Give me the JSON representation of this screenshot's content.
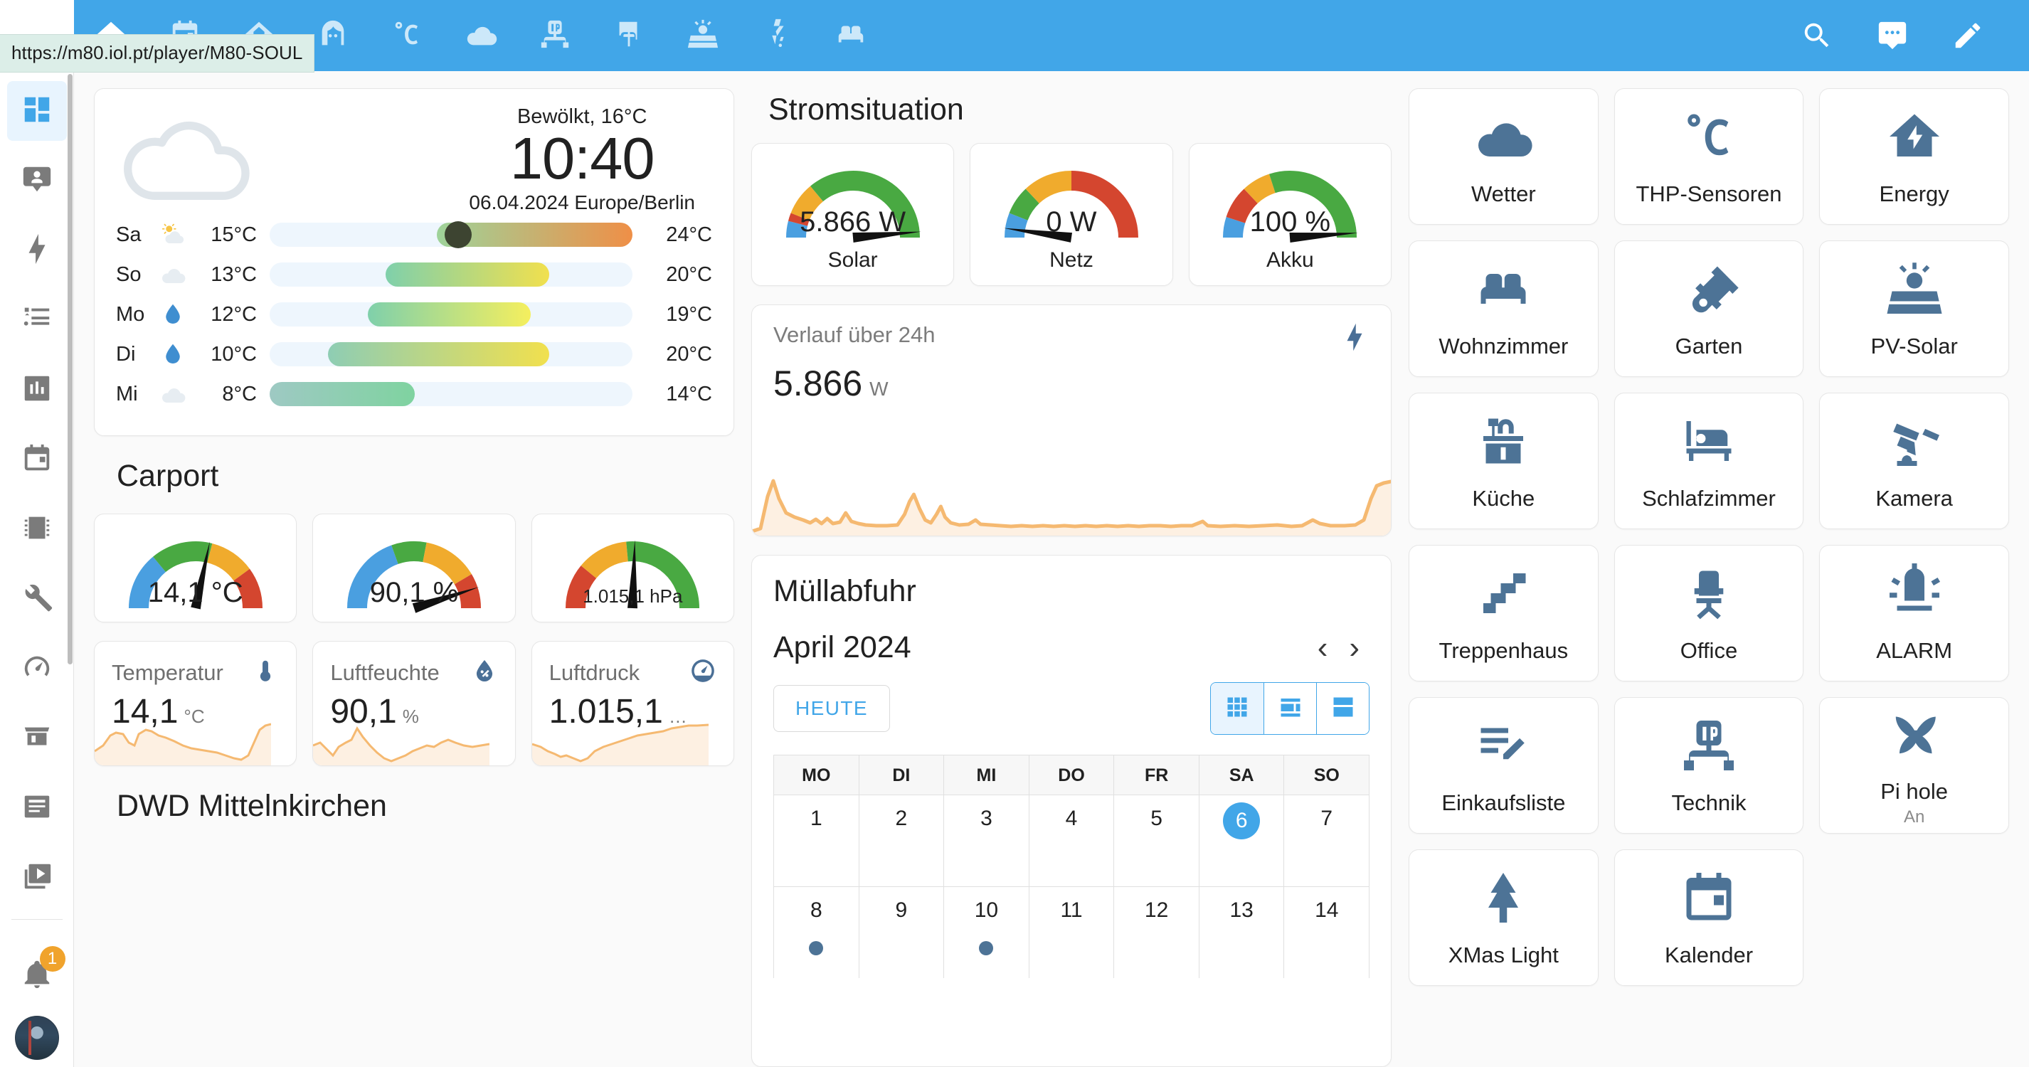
{
  "topbar": {
    "url_tooltip": "https://m80.iol.pt/player/M80-SOUL",
    "tabs": [
      {
        "name": "home",
        "icon": "home-icon",
        "active": true
      },
      {
        "name": "calendar",
        "icon": "calendar-icon",
        "active": false
      },
      {
        "name": "house",
        "icon": "house-icon",
        "active": false
      },
      {
        "name": "person",
        "icon": "person-face-icon",
        "active": false
      },
      {
        "name": "temperature",
        "icon": "celsius-icon",
        "active": false
      },
      {
        "name": "weather",
        "icon": "cloud-icon",
        "active": false
      },
      {
        "name": "network",
        "icon": "ip-network-icon",
        "active": false
      },
      {
        "name": "garage",
        "icon": "garage-door-icon",
        "active": false
      },
      {
        "name": "solar",
        "icon": "solar-panel-icon",
        "active": false
      },
      {
        "name": "energy",
        "icon": "flash-alert-icon",
        "active": false
      },
      {
        "name": "livingroom",
        "icon": "sofa-icon",
        "active": false
      }
    ],
    "actions": [
      {
        "name": "search",
        "icon": "search-icon",
        "label": "Suchen"
      },
      {
        "name": "assist",
        "icon": "assist-icon",
        "label": "Assist"
      },
      {
        "name": "edit",
        "icon": "pencil-icon",
        "label": "Bearbeiten"
      }
    ]
  },
  "sidebar": {
    "items": [
      {
        "name": "overview",
        "icon": "view-dashboard-icon",
        "active": true
      },
      {
        "name": "map",
        "icon": "account-badge-icon",
        "active": false
      },
      {
        "name": "energy",
        "icon": "lightning-bolt-icon",
        "active": false
      },
      {
        "name": "logbook",
        "icon": "format-list-icon",
        "active": false
      },
      {
        "name": "history",
        "icon": "chart-box-icon",
        "active": false
      },
      {
        "name": "calendar",
        "icon": "calendar-icon",
        "active": false
      },
      {
        "name": "esphome",
        "icon": "chip-icon",
        "active": false
      },
      {
        "name": "tools",
        "icon": "wrench-icon",
        "active": false
      },
      {
        "name": "speedtest",
        "icon": "speedometer-icon",
        "active": false
      },
      {
        "name": "hacs",
        "icon": "hacs-icon",
        "active": false,
        "label": "HACS"
      },
      {
        "name": "file-editor",
        "icon": "file-document-icon",
        "active": false
      },
      {
        "name": "media",
        "icon": "media-play-icon",
        "active": false
      }
    ],
    "notifications_count": "1",
    "notification_icon": "bell-icon",
    "avatar": "user-avatar"
  },
  "left_column": {
    "weather": {
      "condition": "Bewölkt, 16°C",
      "time": "10:40",
      "date": "06.04.2024 Europe/Berlin",
      "icon": "cloudy-icon",
      "forecast": [
        {
          "day": "Sa",
          "icon": "partly-cloudy-icon",
          "low": "15°C",
          "high": "24°C",
          "bar_start_pct": 46,
          "bar_end_pct": 100,
          "marker_pct": 52,
          "grad_from": "#9ed39a",
          "grad_to": "#ef8f47"
        },
        {
          "day": "So",
          "icon": "cloudy-icon",
          "low": "13°C",
          "high": "20°C",
          "bar_start_pct": 32,
          "bar_end_pct": 77,
          "marker_pct": null,
          "grad_from": "#7fd0ab",
          "grad_to": "#f1e04e"
        },
        {
          "day": "Mo",
          "icon": "rainy-icon",
          "low": "12°C",
          "high": "19°C",
          "bar_start_pct": 27,
          "bar_end_pct": 72,
          "marker_pct": null,
          "grad_from": "#7fd0ab",
          "grad_to": "#f5ef5e"
        },
        {
          "day": "Di",
          "icon": "rainy-icon",
          "low": "10°C",
          "high": "20°C",
          "bar_start_pct": 16,
          "bar_end_pct": 77,
          "marker_pct": null,
          "grad_from": "#8ecdb4",
          "grad_to": "#f1e04e"
        },
        {
          "day": "Mi",
          "icon": "cloudy-icon",
          "low": "8°C",
          "high": "14°C",
          "bar_start_pct": 0,
          "bar_end_pct": 40,
          "marker_pct": null,
          "grad_from": "#9ec9c3",
          "grad_to": "#7fd3a0"
        }
      ]
    },
    "carport": {
      "title": "Carport",
      "gauges": [
        {
          "name": "temperature",
          "value": "14,1 °C",
          "needle_deg": 102,
          "segments": [
            {
              "color": "#4a9fe0",
              "pct": 28
            },
            {
              "color": "#49a942",
              "pct": 30
            },
            {
              "color": "#f0ab2d",
              "pct": 22
            },
            {
              "color": "#d4462f",
              "pct": 20
            }
          ]
        },
        {
          "name": "humidity",
          "value": "90,1 %",
          "needle_deg": 162,
          "segments": [
            {
              "color": "#4a9fe0",
              "pct": 39
            },
            {
              "color": "#49a942",
              "pct": 17
            },
            {
              "color": "#f0ab2d",
              "pct": 27
            },
            {
              "color": "#d4462f",
              "pct": 17
            }
          ]
        },
        {
          "name": "pressure",
          "value": "1.015,1 hPa",
          "needle_deg": 92,
          "segments": [
            {
              "color": "#d4462f",
              "pct": 22
            },
            {
              "color": "#f0ab2d",
              "pct": 25
            },
            {
              "color": "#49a942",
              "pct": 53
            }
          ]
        }
      ],
      "sensors": [
        {
          "name": "Temperatur",
          "icon": "thermometer-icon",
          "value": "14,1",
          "unit": "°C"
        },
        {
          "name": "Luftfeuchte",
          "icon": "water-percent-icon",
          "value": "90,1",
          "unit": "%"
        },
        {
          "name": "Luftdruck",
          "icon": "gauge-icon",
          "value": "1.015,1",
          "unit": "…"
        }
      ]
    },
    "dwd_title": "DWD Mittelnkirchen"
  },
  "mid_column": {
    "strom": {
      "title": "Stromsituation",
      "gauges": [
        {
          "name": "solar",
          "value": "5.866 W",
          "label": "Solar",
          "needle_deg": 175,
          "segments": [
            {
              "color": "#4a9fe0",
              "pct": 8
            },
            {
              "color": "#d4462f",
              "pct": 4
            },
            {
              "color": "#f0ab2d",
              "pct": 16
            },
            {
              "color": "#49a942",
              "pct": 72
            }
          ]
        },
        {
          "name": "netz",
          "value": "0 W",
          "label": "Netz",
          "needle_deg": 8,
          "segments": [
            {
              "color": "#4a9fe0",
              "pct": 12
            },
            {
              "color": "#49a942",
              "pct": 14
            },
            {
              "color": "#f0ab2d",
              "pct": 24
            },
            {
              "color": "#d4462f",
              "pct": 50
            }
          ]
        },
        {
          "name": "akku",
          "value": "100 %",
          "label": "Akku",
          "needle_deg": 176,
          "segments": [
            {
              "color": "#4a9fe0",
              "pct": 10
            },
            {
              "color": "#d4462f",
              "pct": 16
            },
            {
              "color": "#f0ab2d",
              "pct": 14
            },
            {
              "color": "#49a942",
              "pct": 60
            }
          ]
        }
      ]
    },
    "history": {
      "title": "Verlauf über 24h",
      "value": "5.866",
      "unit": "W",
      "icon": "flash-icon"
    },
    "calendar": {
      "title": "Müllabfuhr",
      "month": "April 2024",
      "prev_label": "‹",
      "next_label": "›",
      "today_label": "HEUTE",
      "views": [
        {
          "name": "month-view",
          "icon": "view-module-icon",
          "active": true
        },
        {
          "name": "week-view",
          "icon": "view-week-icon",
          "active": false
        },
        {
          "name": "day-view",
          "icon": "view-day-icon",
          "active": false
        }
      ],
      "weekday_headers": [
        "MO",
        "DI",
        "MI",
        "DO",
        "FR",
        "SA",
        "SO"
      ],
      "weeks": [
        [
          {
            "num": "1",
            "today": false,
            "event": false
          },
          {
            "num": "2",
            "today": false,
            "event": false
          },
          {
            "num": "3",
            "today": false,
            "event": false
          },
          {
            "num": "4",
            "today": false,
            "event": false
          },
          {
            "num": "5",
            "today": false,
            "event": false
          },
          {
            "num": "6",
            "today": true,
            "event": false
          },
          {
            "num": "7",
            "today": false,
            "event": false
          }
        ],
        [
          {
            "num": "8",
            "today": false,
            "event": true
          },
          {
            "num": "9",
            "today": false,
            "event": false
          },
          {
            "num": "10",
            "today": false,
            "event": true
          },
          {
            "num": "11",
            "today": false,
            "event": false
          },
          {
            "num": "12",
            "today": false,
            "event": false
          },
          {
            "num": "13",
            "today": false,
            "event": false
          },
          {
            "num": "14",
            "today": false,
            "event": false
          }
        ]
      ]
    }
  },
  "tiles": [
    {
      "label": "Wetter",
      "icon": "cloud-icon",
      "state": null
    },
    {
      "label": "THP-Sensoren",
      "icon": "celsius-icon",
      "state": null
    },
    {
      "label": "Energy",
      "icon": "home-lightning-icon",
      "state": null
    },
    {
      "label": "Wohnzimmer",
      "icon": "sofa-icon",
      "state": null
    },
    {
      "label": "Garten",
      "icon": "shovel-icon",
      "state": null
    },
    {
      "label": "PV-Solar",
      "icon": "solar-panel-icon",
      "state": null
    },
    {
      "label": "Küche",
      "icon": "kitchen-sink-icon",
      "state": null
    },
    {
      "label": "Schlafzimmer",
      "icon": "bed-icon",
      "state": null
    },
    {
      "label": "Kamera",
      "icon": "cctv-icon",
      "state": null
    },
    {
      "label": "Treppenhaus",
      "icon": "stairs-icon",
      "state": null
    },
    {
      "label": "Office",
      "icon": "office-chair-icon",
      "state": null
    },
    {
      "label": "ALARM",
      "icon": "alarm-light-icon",
      "state": null
    },
    {
      "label": "Einkaufsliste",
      "icon": "list-edit-icon",
      "state": null
    },
    {
      "label": "Technik",
      "icon": "ip-network-icon",
      "state": null
    },
    {
      "label": "Pi hole",
      "icon": "pi-hole-icon",
      "state": "An"
    },
    {
      "label": "XMas Light",
      "icon": "pine-tree-icon",
      "state": null
    },
    {
      "label": "Kalender",
      "icon": "calendar-icon",
      "state": null
    }
  ],
  "colors": {
    "accent": "#41a6e8",
    "tile_icon": "#4d7396",
    "gauge_green": "#49a942",
    "gauge_yellow": "#f0ab2d",
    "gauge_red": "#d4462f",
    "gauge_blue": "#4a9fe0",
    "spark": "#f5b971"
  }
}
